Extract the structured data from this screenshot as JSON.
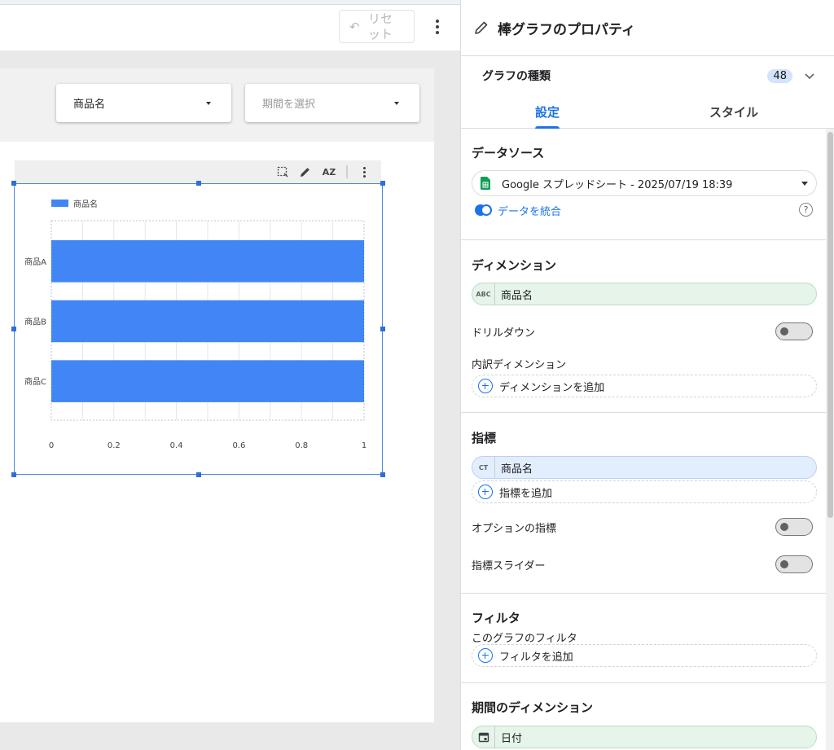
{
  "toolbar": {
    "reset_label": "リセット",
    "more_icon": "more-vert-icon",
    "undo_icon": "undo-icon"
  },
  "filters": {
    "product_dropdown": "商品名",
    "period_dropdown": "期間を選択"
  },
  "chart_toolbar": {
    "icons": [
      "select-icon",
      "pencil-icon",
      "sort-az-icon",
      "more-vert-icon"
    ],
    "sort_label": "AZ"
  },
  "chart_data": {
    "type": "bar",
    "orientation": "horizontal",
    "categories": [
      "商品A",
      "商品B",
      "商品C"
    ],
    "series": [
      {
        "name": "商品名",
        "values": [
          1,
          1,
          1
        ]
      }
    ],
    "xlim": [
      0,
      1
    ],
    "x_ticks": [
      "0",
      "0.2",
      "0.4",
      "0.6",
      "0.8",
      "1"
    ],
    "legend": "top-left",
    "grid": true,
    "color": "#4285f4"
  },
  "panel": {
    "title": "棒グラフのプロパティ",
    "chart_type_label": "グラフの種類",
    "chart_type_badge": "48",
    "tabs": {
      "settings": "設定",
      "style": "スタイル"
    },
    "data_source": {
      "title": "データソース",
      "selected": "Google スプレッドシート - 2025/07/19 18:39",
      "blend_link": "データを統合",
      "help": "?"
    },
    "dimension": {
      "title": "ディメンション",
      "chip_type": "ABC",
      "chip_label": "商品名",
      "drilldown_label": "ドリルダウン",
      "breakdown_label": "内訳ディメンション",
      "add_label": "ディメンションを追加"
    },
    "metric": {
      "title": "指標",
      "chip_type": "CT",
      "chip_label": "商品名",
      "add_label": "指標を追加",
      "optional_label": "オプションの指標",
      "slider_label": "指標スライダー"
    },
    "filter": {
      "title": "フィルタ",
      "subtitle": "このグラフのフィルタ",
      "add_label": "フィルタを追加"
    },
    "date_dimension": {
      "title": "期間のディメンション",
      "chip_label": "日付"
    }
  }
}
